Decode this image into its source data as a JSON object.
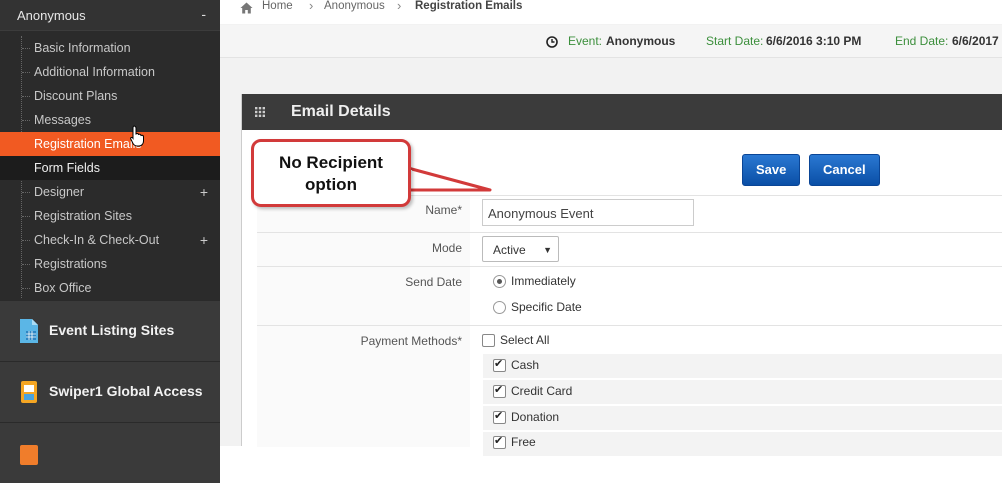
{
  "sidebar": {
    "event_name": "Anonymous",
    "collapse": "-",
    "items": [
      {
        "label": "Basic Information"
      },
      {
        "label": "Additional Information"
      },
      {
        "label": "Discount Plans"
      },
      {
        "label": "Messages"
      },
      {
        "label": "Registration Emails"
      },
      {
        "label": "Form Fields"
      },
      {
        "label": "Designer",
        "expand": "+"
      },
      {
        "label": "Registration Sites"
      },
      {
        "label": "Check-In & Check-Out",
        "expand": "+"
      },
      {
        "label": "Registrations"
      },
      {
        "label": "Box Office"
      }
    ],
    "sections": [
      {
        "label": "Event Listing Sites"
      },
      {
        "label": "Swiper1 Global Access"
      }
    ]
  },
  "breadcrumb": [
    "Home",
    "Anonymous",
    "Registration Emails"
  ],
  "event_bar": {
    "event_label": "Event:",
    "event_value": "Anonymous",
    "start_label": "Start Date:",
    "start_value": "6/6/2016 3:10 PM",
    "end_label": "End Date:",
    "end_value": "6/6/2017"
  },
  "panel": {
    "title": "Email Details"
  },
  "buttons": {
    "save": "Save",
    "cancel": "Cancel"
  },
  "callout": {
    "line1": "No Recipient",
    "line2": "option"
  },
  "form": {
    "name_label": "Name*",
    "name_value": "Anonymous Event",
    "mode_label": "Mode",
    "mode_value": "Active",
    "send_date_label": "Send Date",
    "send_options": [
      "Immediately",
      "Specific Date"
    ],
    "payment_label": "Payment Methods*",
    "select_all": "Select All",
    "payments": [
      "Cash",
      "Credit Card",
      "Donation",
      "Free"
    ]
  },
  "colors": {
    "accent": "#f15a22",
    "button": "#0a4fa6",
    "callout_border": "#d23a3a"
  }
}
